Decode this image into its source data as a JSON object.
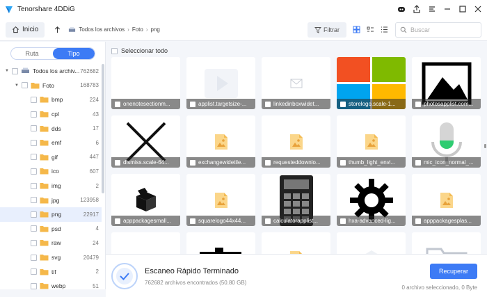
{
  "app": {
    "title": "Tenorshare 4DDiG"
  },
  "nav": {
    "home_label": "Inicio",
    "breadcrumbs": [
      "Todos los archivos",
      "Foto",
      "png"
    ],
    "filter_label": "Filtrar",
    "search_placeholder": "Buscar"
  },
  "sidebar": {
    "tabs": [
      {
        "label": "Ruta",
        "active": false
      },
      {
        "label": "Tipo",
        "active": true
      }
    ],
    "tree": [
      {
        "label": "Todos los archiv...",
        "count": "762682",
        "level": 0,
        "icon": "drive-icon"
      },
      {
        "label": "Foto",
        "count": "168783",
        "level": 1,
        "icon": "folder-icon"
      },
      {
        "label": "bmp",
        "count": "224",
        "level": 2,
        "icon": "folder-icon"
      },
      {
        "label": "cpl",
        "count": "43",
        "level": 2,
        "icon": "folder-icon"
      },
      {
        "label": "dds",
        "count": "17",
        "level": 2,
        "icon": "folder-icon"
      },
      {
        "label": "emf",
        "count": "6",
        "level": 2,
        "icon": "folder-icon"
      },
      {
        "label": "gif",
        "count": "447",
        "level": 2,
        "icon": "folder-icon"
      },
      {
        "label": "ico",
        "count": "607",
        "level": 2,
        "icon": "folder-icon"
      },
      {
        "label": "img",
        "count": "2",
        "level": 2,
        "icon": "folder-icon"
      },
      {
        "label": "jpg",
        "count": "123958",
        "level": 2,
        "icon": "folder-icon"
      },
      {
        "label": "png",
        "count": "22917",
        "level": 2,
        "icon": "folder-icon",
        "selected": true
      },
      {
        "label": "psd",
        "count": "4",
        "level": 2,
        "icon": "folder-icon"
      },
      {
        "label": "raw",
        "count": "24",
        "level": 2,
        "icon": "folder-icon"
      },
      {
        "label": "svg",
        "count": "20479",
        "level": 2,
        "icon": "folder-icon"
      },
      {
        "label": "tif",
        "count": "2",
        "level": 2,
        "icon": "folder-icon"
      },
      {
        "label": "webp",
        "count": "51",
        "level": 2,
        "icon": "folder-icon"
      }
    ]
  },
  "main": {
    "select_all_label": "Seleccionar todo",
    "files": [
      {
        "name": "onenotesectionm...",
        "thumb": "blank"
      },
      {
        "name": "applist.targetsize-...",
        "thumb": "faint-play"
      },
      {
        "name": "linkedinboxwidet...",
        "thumb": "faint-mail"
      },
      {
        "name": "storelogo.scale-1...",
        "thumb": "windows-logo"
      },
      {
        "name": "photosapplist.com...",
        "thumb": "photo-icon"
      },
      {
        "name": "dismiss.scale-64...",
        "thumb": "x-mark"
      },
      {
        "name": "exchangewidetile...",
        "thumb": "image-placeholder"
      },
      {
        "name": "requesteddownlo...",
        "thumb": "image-placeholder"
      },
      {
        "name": "thumb_light_envi...",
        "thumb": "image-placeholder"
      },
      {
        "name": "mic_icon_normal_...",
        "thumb": "mic-icon"
      },
      {
        "name": "apppackagesmall...",
        "thumb": "package-icon"
      },
      {
        "name": "squarelogo44x44...",
        "thumb": "image-placeholder"
      },
      {
        "name": "calculatorapplist...",
        "thumb": "calculator-icon"
      },
      {
        "name": "hxa-advanced-lig...",
        "thumb": "gear-icon"
      },
      {
        "name": "apppackagesplas...",
        "thumb": "image-placeholder"
      },
      {
        "name": "",
        "thumb": "blank"
      },
      {
        "name": "",
        "thumb": "puzzle-icon"
      },
      {
        "name": "",
        "thumb": "image-placeholder"
      },
      {
        "name": "",
        "thumb": "faint-box"
      },
      {
        "name": "",
        "thumb": "faint-folder"
      }
    ]
  },
  "status": {
    "title": "Escaneo Rápido Terminado",
    "subtitle": "762682 archivos encontrados (50.80 GB)",
    "recover_label": "Recuperar",
    "selection_info": "0 archivo seleccionado, 0 Byte"
  },
  "colors": {
    "accent": "#3d7bf5",
    "folder": "#f5b84a"
  }
}
